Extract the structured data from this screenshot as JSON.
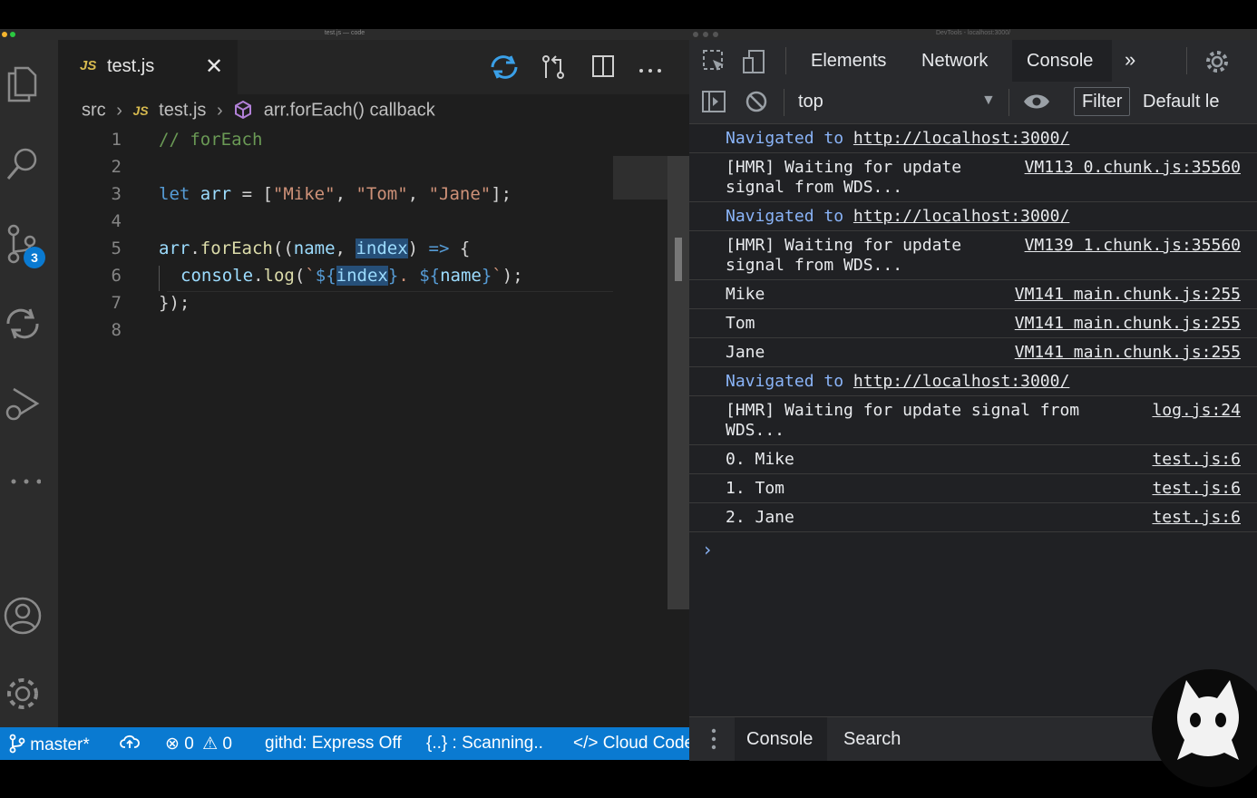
{
  "vscode": {
    "window_title": "test.js — code",
    "tab": {
      "badge": "JS",
      "filename": "test.js"
    },
    "scm_badge_count": "3",
    "breadcrumb": {
      "folder": "src",
      "badge": "JS",
      "file": "test.js",
      "symbol": "arr.forEach() callback"
    },
    "code_lines": [
      {
        "num": "1",
        "text": "// forEach"
      },
      {
        "num": "2",
        "text": ""
      },
      {
        "num": "3",
        "text": "let arr = [\"Mike\", \"Tom\", \"Jane\"];"
      },
      {
        "num": "4",
        "text": ""
      },
      {
        "num": "5",
        "text": "arr.forEach((name, index) => {"
      },
      {
        "num": "6",
        "text": "console.log(`${index}. ${name}`);"
      },
      {
        "num": "7",
        "text": "});"
      },
      {
        "num": "8",
        "text": ""
      }
    ],
    "status_bar": {
      "branch": "master*",
      "errors": "0",
      "warnings": "0",
      "githd": "githd: Express Off",
      "scanning": "{..} : Scanning..",
      "cloud_code": "Cloud Code"
    },
    "colors": {
      "status_bar": "#0a7ad1",
      "editor_bg": "#1e1e1e",
      "activity_bar": "#2c2c2c"
    }
  },
  "devtools": {
    "window_title": "DevTools - localhost:3000/",
    "tabs": [
      "Elements",
      "Network",
      "Console"
    ],
    "active_tab": "Console",
    "context": "top",
    "filter_label": "Filter",
    "levels_label": "Default le",
    "messages": [
      {
        "type": "nav",
        "prefix": "Navigated to ",
        "link": "http://localhost:3000/"
      },
      {
        "type": "log",
        "text": "[HMR] Waiting for update\nsignal from WDS...",
        "source": "VM113 0.chunk.js:35560"
      },
      {
        "type": "nav",
        "prefix": "Navigated to ",
        "link": "http://localhost:3000/"
      },
      {
        "type": "log",
        "text": "[HMR] Waiting for update\nsignal from WDS...",
        "source": "VM139 1.chunk.js:35560"
      },
      {
        "type": "log",
        "text": "Mike",
        "source": "VM141 main.chunk.js:255"
      },
      {
        "type": "log",
        "text": "Tom",
        "source": "VM141 main.chunk.js:255"
      },
      {
        "type": "log",
        "text": "Jane",
        "source": "VM141 main.chunk.js:255"
      },
      {
        "type": "nav",
        "prefix": "Navigated to ",
        "link": "http://localhost:3000/"
      },
      {
        "type": "log",
        "text": "[HMR] Waiting for update signal from\nWDS...",
        "source": "log.js:24"
      },
      {
        "type": "log",
        "text": "0. Mike",
        "source": "test.js:6"
      },
      {
        "type": "log",
        "text": "1. Tom",
        "source": "test.js:6"
      },
      {
        "type": "log",
        "text": "2. Jane",
        "source": "test.js:6"
      }
    ],
    "prompt": "›",
    "drawer_tabs": [
      "Console",
      "Search"
    ],
    "colors": {
      "nav": "#8ab4f8",
      "bg": "#202124",
      "toolbar": "#292a2d"
    }
  }
}
